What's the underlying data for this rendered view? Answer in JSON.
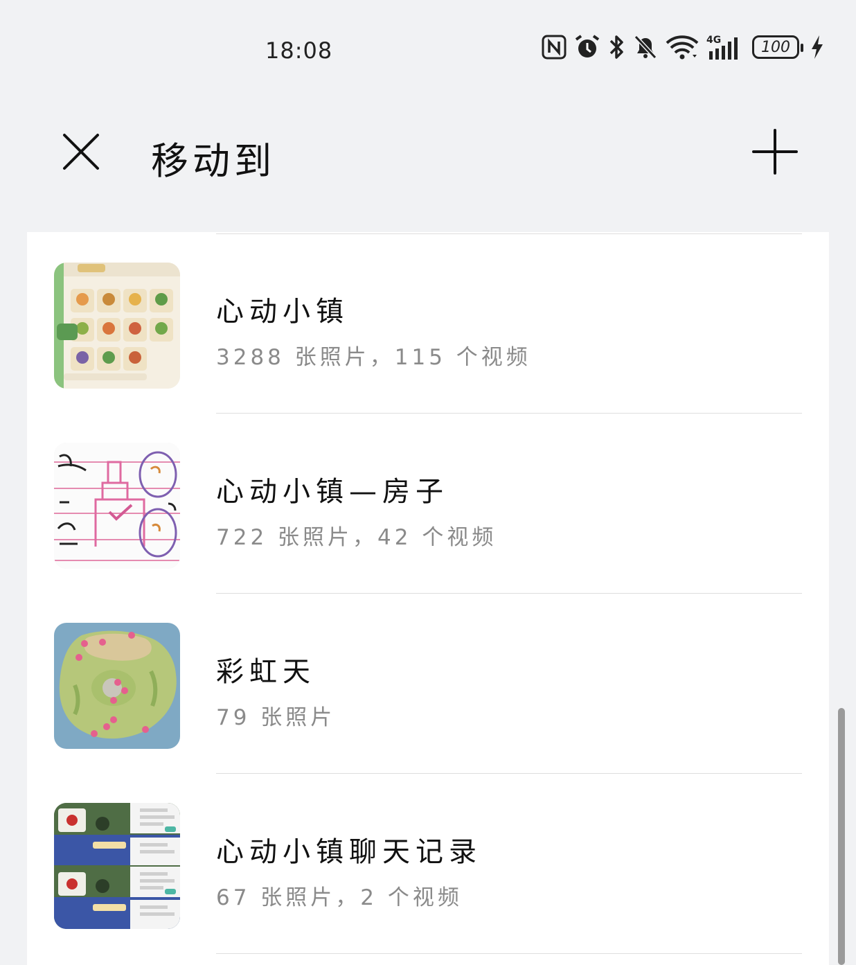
{
  "status_bar": {
    "time": "18:08",
    "battery": "100",
    "icons": [
      "nfc-icon",
      "alarm-icon",
      "bluetooth-icon",
      "mute-bell-icon",
      "wifi-icon",
      "signal-4g-icon",
      "battery-icon",
      "charging-icon"
    ]
  },
  "header": {
    "title": "移动到",
    "close_icon": "close-icon",
    "add_icon": "plus-icon"
  },
  "albums": [
    {
      "name": "心动小镇",
      "count": "3288 张照片，115 个视频",
      "thumb": "game-inventory-screenshot"
    },
    {
      "name": "心动小镇—房子",
      "count": "722 张照片，42 个视频",
      "thumb": "handwritten-sketch"
    },
    {
      "name": "彩虹天",
      "count": "79 张照片",
      "thumb": "island-map"
    },
    {
      "name": "心动小镇聊天记录",
      "count": "67 张照片，2 个视频",
      "thumb": "chat-screenshot-collage"
    }
  ],
  "colors": {
    "background": "#f1f2f4",
    "card": "#ffffff",
    "secondary_text": "#8a8a8a",
    "divider": "#dedede"
  }
}
